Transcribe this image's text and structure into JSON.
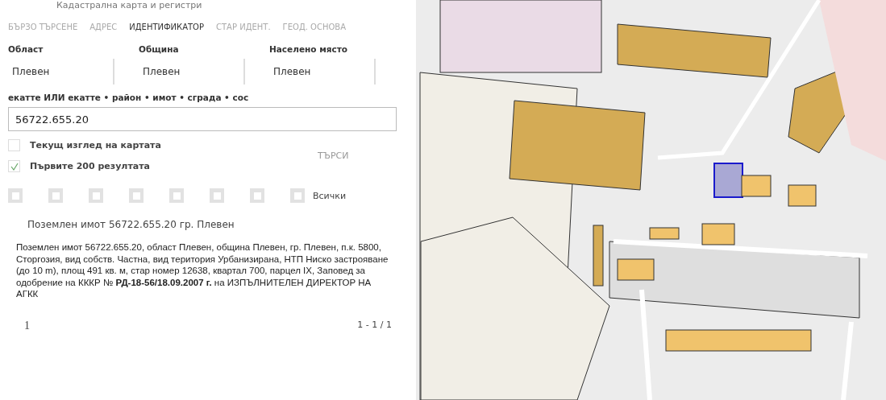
{
  "header": {
    "title": "Кадастрална карта и регистри"
  },
  "tabs": [
    {
      "label": "БЪРЗО ТЪРСЕНЕ",
      "selected": false
    },
    {
      "label": "АДРЕС",
      "selected": false
    },
    {
      "label": "ИДЕНТИФИКАТОР",
      "selected": true
    },
    {
      "label": "СТАР ИДЕНТ.",
      "selected": false
    },
    {
      "label": "ГЕОД. ОСНОВА",
      "selected": false
    }
  ],
  "selects": [
    {
      "label": "Област",
      "value": "Плевен"
    },
    {
      "label": "Община",
      "value": "Плевен"
    },
    {
      "label": "Населено място",
      "value": "Плевен"
    }
  ],
  "query": {
    "label": "екатте ИЛИ екатте • район • имот • сграда • сос",
    "value": "56722.655.20"
  },
  "options": [
    {
      "label": "Текущ изглед на картата",
      "checked": false
    },
    {
      "label": "Първите 200 резултата",
      "checked": true
    }
  ],
  "search_button": "ТЪРСИ",
  "filters": [
    {
      "checked": false
    },
    {
      "checked": false
    },
    {
      "checked": false
    },
    {
      "checked": false
    },
    {
      "checked": false
    },
    {
      "checked": false
    },
    {
      "checked": false
    },
    {
      "checked": false,
      "label": "Всички"
    }
  ],
  "result": {
    "title": "Поземлен имот 56722.655.20 гр. Плевен",
    "description": "Поземлен имот 56722.655.20, област Плевен, община Плевен, гр. Плевен, п.к. 5800, Сторгозия, вид собств. Частна, вид територия Урбанизирана, НТП Ниско застрояване (до 10 m), площ 491 кв. м, стар номер 12638, квартал 700, парцел IX, Заповед за одобрение на КККР № **РД-18-56/18.09.2007 г.** на ИЗПЪЛНИТЕЛЕН ДИРЕКТОР НА АГКК"
  },
  "pagination": {
    "page": "1",
    "range": "1 - 1 / 1"
  }
}
